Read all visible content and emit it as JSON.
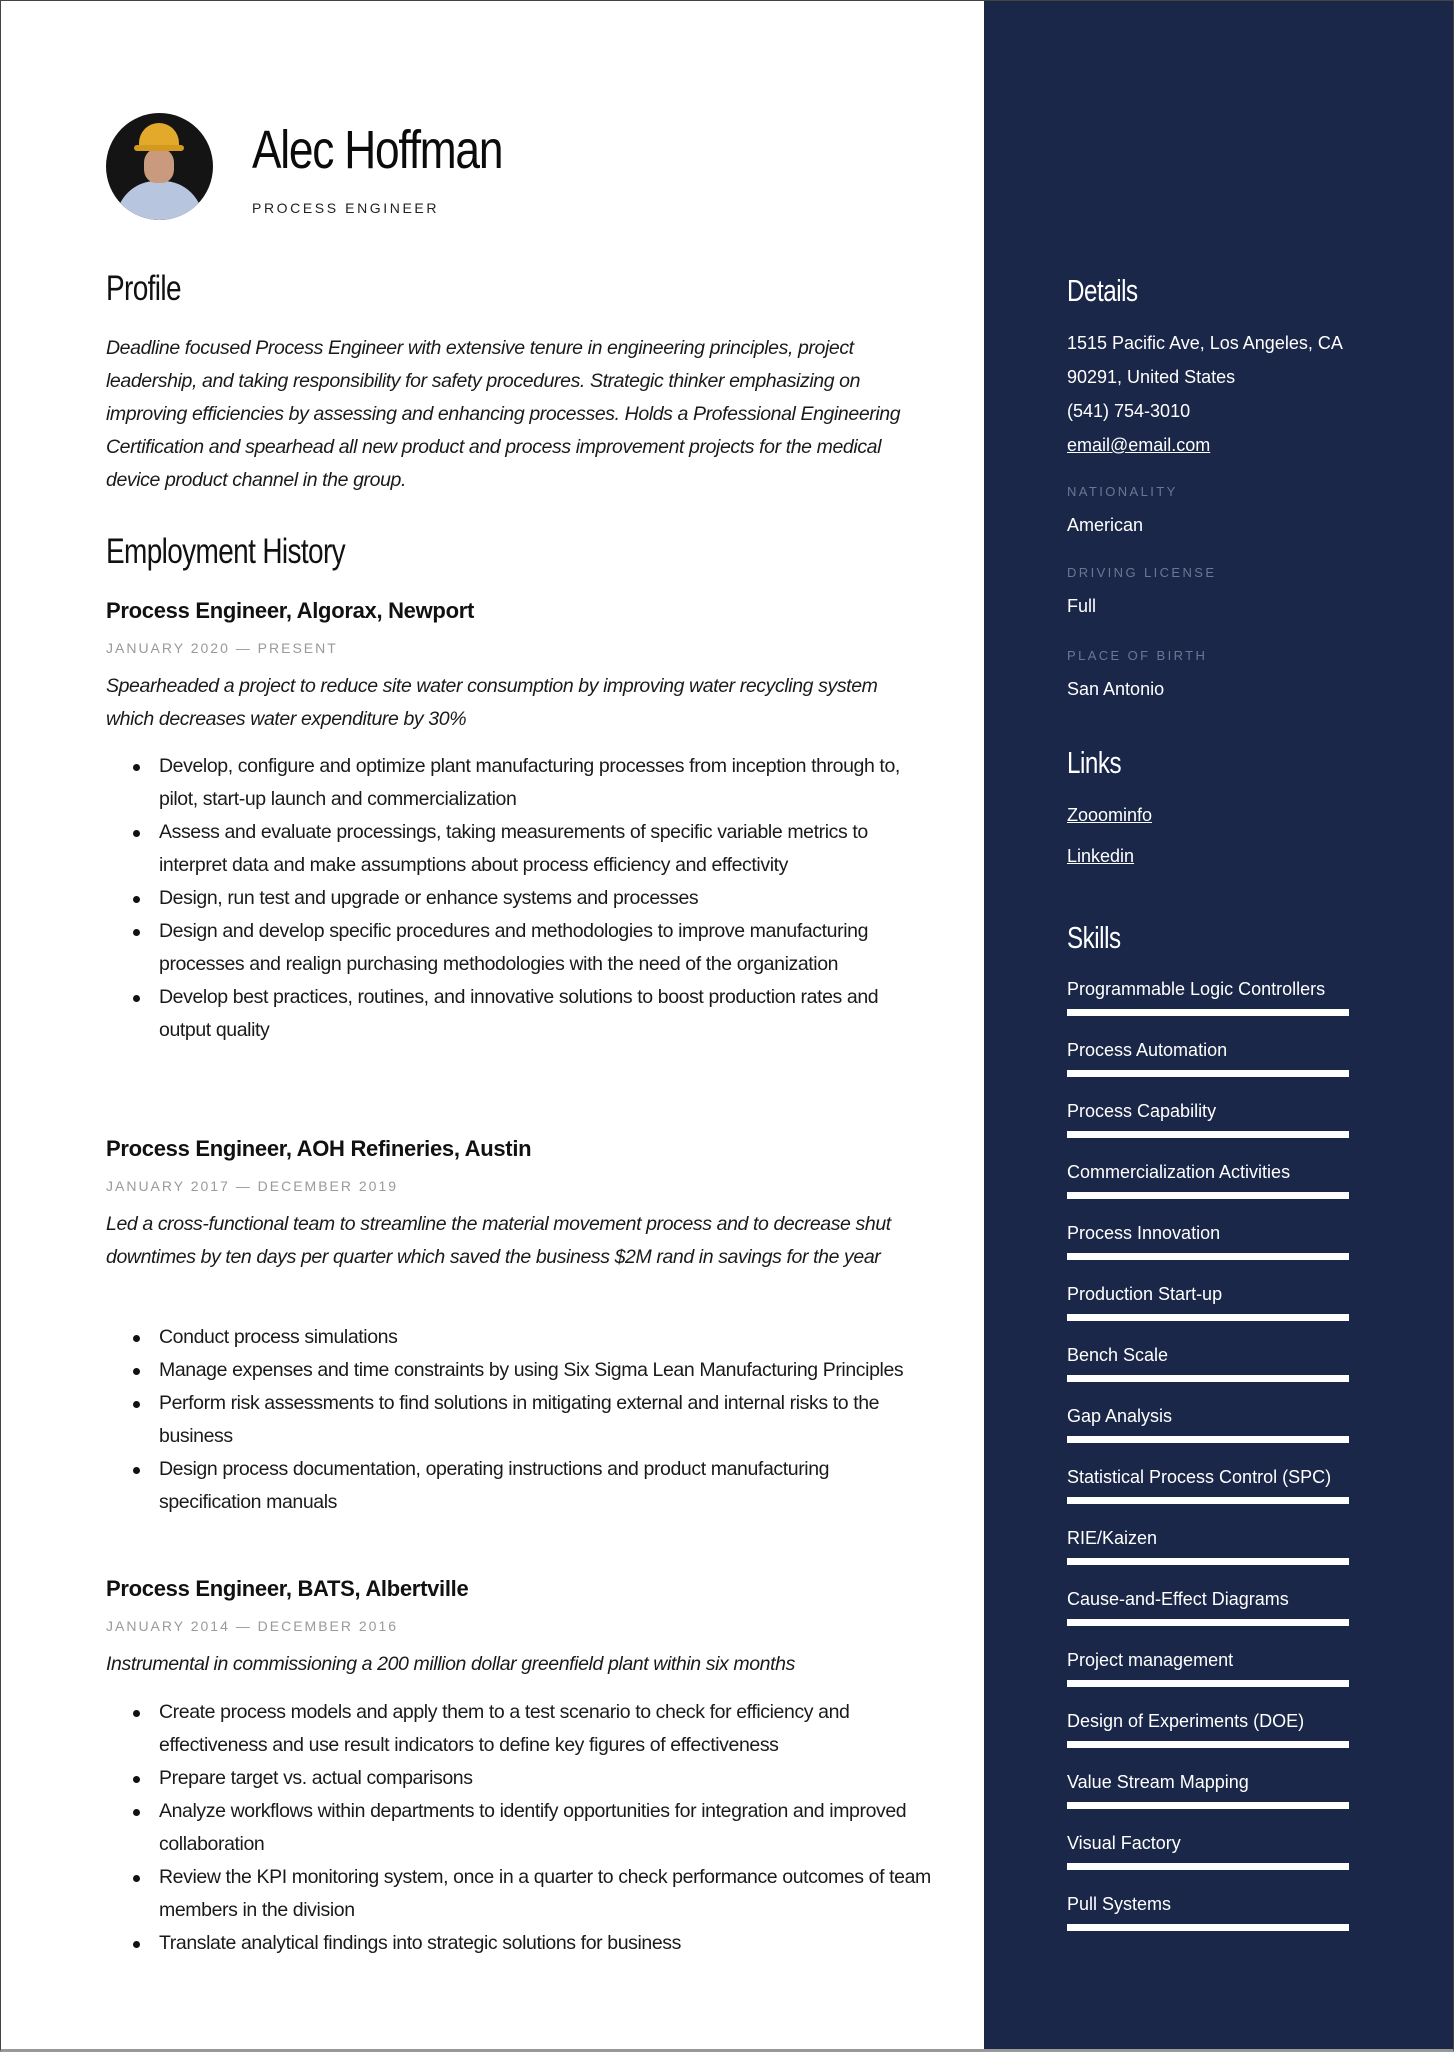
{
  "header": {
    "name": "Alec Hoffman",
    "title": "PROCESS ENGINEER"
  },
  "profile": {
    "heading": "Profile",
    "text": "Deadline focused Process Engineer with extensive tenure in engineering principles, project leadership, and taking responsibility for safety procedures. Strategic thinker emphasizing on improving efficiencies by assessing and enhancing processes. Holds a Professional Engineering Certification and spearhead all new product and process improvement projects for the medical device product channel in the group."
  },
  "employment": {
    "heading": "Employment History",
    "jobs": [
      {
        "title": "Process Engineer, Algorax, Newport",
        "dates": "JANUARY 2020 — PRESENT",
        "summary": "Spearheaded a project to reduce site water consumption by improving water recycling system which decreases water expenditure by 30%",
        "bullets": [
          "Develop, configure and optimize plant manufacturing processes from inception through to, pilot, start-up launch and commercialization",
          "Assess and evaluate processings, taking measurements of specific variable metrics to interpret data and make assumptions about process efficiency and effectivity",
          "Design, run test and upgrade or enhance systems and processes",
          "Design and develop specific procedures and methodologies to improve manufacturing processes and realign purchasing methodologies with the need of the organization",
          "Develop best practices, routines, and innovative solutions to boost production rates and output quality"
        ]
      },
      {
        "title": "Process Engineer, AOH Refineries, Austin",
        "dates": "JANUARY 2017 — DECEMBER 2019",
        "summary": "Led a cross-functional team to streamline the material movement process and to decrease shut downtimes by ten days per quarter which saved the business $2M rand in savings for the year",
        "bullets": [
          "Conduct process simulations",
          "Manage expenses and time constraints by using Six Sigma Lean Manufacturing Principles",
          "Perform risk assessments to find solutions in mitigating external and internal risks to the business",
          "Design process documentation, operating instructions and product manufacturing specification manuals"
        ]
      },
      {
        "title": "Process Engineer, BATS, Albertville",
        "dates": "JANUARY 2014 — DECEMBER 2016",
        "summary": "Instrumental in commissioning a 200 million dollar greenfield plant within six months",
        "bullets": [
          "Create process models and apply them to a test scenario to check for efficiency and effectiveness and use result indicators to define key figures of effectiveness",
          "Prepare target vs. actual comparisons",
          "Analyze workflows within departments to identify opportunities for integration and improved collaboration",
          "Review the KPI monitoring system, once in a quarter to check performance outcomes of team members in the division",
          "Translate analytical findings into strategic solutions for business"
        ]
      }
    ]
  },
  "sidebar": {
    "details": {
      "heading": "Details",
      "address_line1": "1515 Pacific Ave, Los Angeles, CA",
      "address_line2": "90291, United States",
      "phone": "(541) 754-3010",
      "email": "email@email.com",
      "nationality_label": "NATIONALITY",
      "nationality": "American",
      "license_label": "DRIVING LICENSE",
      "license": "Full",
      "birth_label": "PLACE OF BIRTH",
      "birth": "San Antonio"
    },
    "links": {
      "heading": "Links",
      "items": [
        "Zooominfo",
        "Linkedin"
      ]
    },
    "skills": {
      "heading": "Skills",
      "items": [
        {
          "name": "Programmable Logic Controllers",
          "level": 1.0
        },
        {
          "name": "Process Automation",
          "level": 1.0
        },
        {
          "name": "Process Capability",
          "level": 1.0
        },
        {
          "name": "Commercialization Activities",
          "level": 1.0
        },
        {
          "name": "Process Innovation",
          "level": 1.0
        },
        {
          "name": "Production Start-up",
          "level": 1.0
        },
        {
          "name": "Bench Scale",
          "level": 1.0
        },
        {
          "name": "Gap Analysis",
          "level": 1.0
        },
        {
          "name": "Statistical Process Control (SPC)",
          "level": 1.0
        },
        {
          "name": "RIE/Kaizen",
          "level": 1.0
        },
        {
          "name": "Cause-and-Effect Diagrams",
          "level": 1.0
        },
        {
          "name": "Project management",
          "level": 1.0
        },
        {
          "name": "Design of Experiments (DOE)",
          "level": 1.0
        },
        {
          "name": "Value Stream Mapping",
          "level": 1.0
        },
        {
          "name": "Visual Factory",
          "level": 1.0
        },
        {
          "name": "Pull Systems",
          "level": 1.0
        }
      ]
    }
  },
  "colors": {
    "sidebar_bg": "#1a2748",
    "sidebar_label": "#6b7795",
    "date_gray": "#9a9a9a"
  }
}
